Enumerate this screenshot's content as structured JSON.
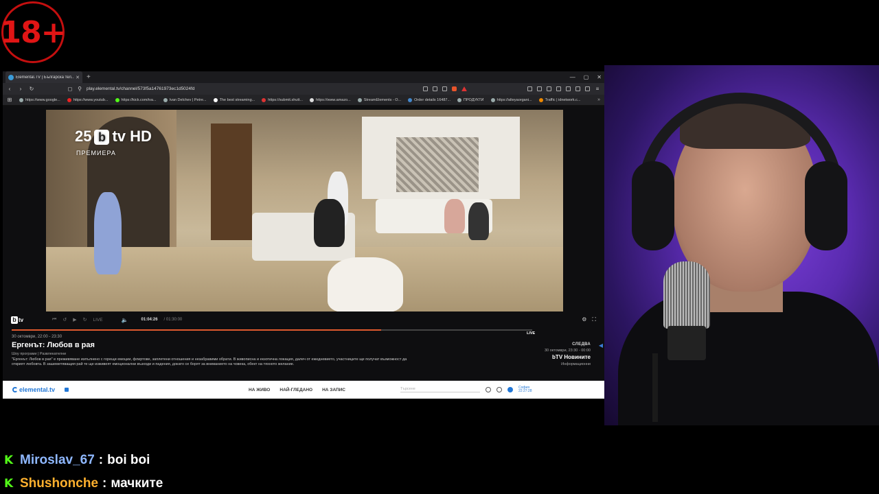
{
  "overlay": {
    "age_badge": "18+"
  },
  "browser": {
    "tab_title": "Elemental.TV | Българска тел...",
    "url": "play.elemental.tv/channel/573f5a14761973ec1d5024fd",
    "bookmarks": [
      "https://www.google...",
      "https://www.youtub...",
      "https://kick.com/iva...",
      "Ivan Delchev | Petre...",
      "The best streaming...",
      "https://submit.shutt...",
      "https://www.amazo...",
      "StreamElements - O...",
      "Order details 16487...",
      "ПРОДУКТИ",
      "https://alteyaorgani...",
      "Traffic | idnetwork.c..."
    ]
  },
  "player": {
    "channel_logo": "25",
    "channel_logo_b": "b",
    "channel_logo_suffix": "tv HD",
    "premiere_label": "ПРЕМИЕРА",
    "controls": {
      "live_label": "LIVE",
      "time_current": "01:04:26",
      "time_duration": "/ 01:30:00",
      "live_tag": "LIVE",
      "progress": 0.71
    },
    "program": {
      "date": "30 октомври, 22:00 - 23:30",
      "title": "Ергенът: Любов в рая",
      "genre": "Шоу програми | Развлекателни",
      "description": "\"Ергенът: Любов в рая\" е преживяване изпълнено с горещи емоции, флиртове, заплетени отношения и незабравими обрати. В живописна и екзотична локация, далеч от ежедневието, участниците ще получат възможност да открият любовта. В зашеметяващия рай те ще изживеят емоционални възходи и падения, докато се борят за вниманието на човека, обект на тяхното желание."
    },
    "next": {
      "label": "СЛЕДВА",
      "date": "30 октомври, 23:30 - 00:00",
      "title": "bTV Новините",
      "category": "Информационни"
    }
  },
  "site": {
    "logo": "elemental.tv",
    "nav": [
      "НА ЖИВО",
      "НАЙ-ГЛЕДАНО",
      "НА ЗАПИС"
    ],
    "search_placeholder": "Търсене",
    "user_line1": "София",
    "user_line2": "22:27:28"
  },
  "chat": [
    {
      "user": "Miroslav_67",
      "user_color": "#8fb8ff",
      "message": "boi boi"
    },
    {
      "user": "Shushonche",
      "user_color": "#ffb02e",
      "message": "мачките"
    }
  ]
}
